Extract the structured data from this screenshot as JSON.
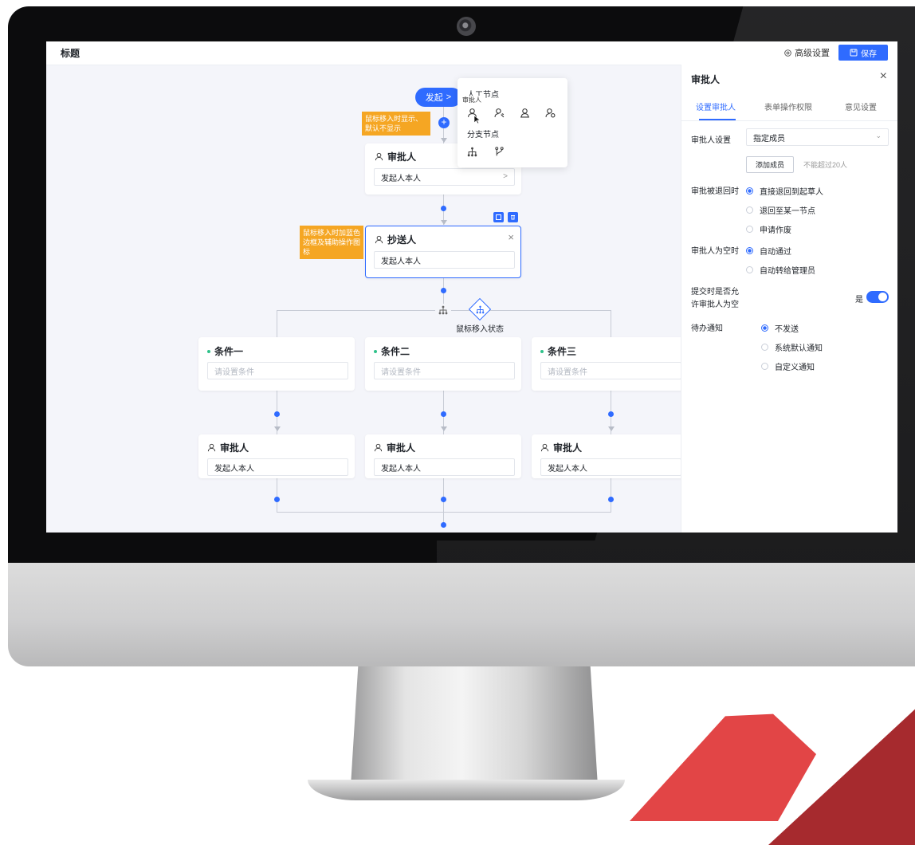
{
  "app": {
    "title": "标题",
    "advanced_label": "高级设置",
    "save_label": "保存"
  },
  "flow": {
    "start_label": "发起",
    "start_tooltip": "鼠标移入时显示、默认不显示",
    "approver_card": {
      "title": "审批人",
      "value": "发起人本人"
    },
    "cc_tooltip": "鼠标移入时加蓝色边框及辅助操作图标",
    "cc_card": {
      "title": "抄送人",
      "value": "发起人本人"
    },
    "branch_hover_label": "鼠标移入状态",
    "conditions": [
      {
        "title": "条件一",
        "placeholder": "请设置条件"
      },
      {
        "title": "条件二",
        "placeholder": "请设置条件"
      },
      {
        "title": "条件三",
        "placeholder": "请设置条件"
      }
    ],
    "branch_approvers": [
      {
        "title": "审批人",
        "value": "发起人本人"
      },
      {
        "title": "审批人",
        "value": "发起人本人"
      },
      {
        "title": "审批人",
        "value": "发起人本人"
      }
    ]
  },
  "popup": {
    "section1_title": "人工节点",
    "hover_tip": "审批人",
    "section2_title": "分支节点",
    "icons_row1": [
      "approver-icon",
      "handler-icon",
      "cc-person-icon",
      "stamp-person-icon"
    ],
    "icons_row2": [
      "branch-tree-icon",
      "parallel-branch-icon"
    ]
  },
  "panel": {
    "title": "审批人",
    "tabs": [
      "设置审批人",
      "表单操作权限",
      "意见设置"
    ],
    "active_tab": 0,
    "approver_setting": {
      "label": "审批人设置",
      "value": "指定成员"
    },
    "add_member": {
      "label": "添加成员",
      "hint": "不能超过20人"
    },
    "rejected": {
      "label": "审批被退回时",
      "options": [
        "直接退回到起草人",
        "退回至某一节点",
        "申请作废"
      ],
      "selected": 0
    },
    "empty_approver": {
      "label": "审批人为空时",
      "options": [
        "自动通过",
        "自动转给管理员"
      ],
      "selected": 0
    },
    "allow_empty": {
      "label_line1": "提交时是否允",
      "label_line2": "许审批人为空",
      "value_label": "是"
    },
    "notify": {
      "label": "待办通知",
      "options": [
        "不发送",
        "系统默认通知",
        "自定义通知"
      ],
      "selected": 0
    }
  },
  "colors": {
    "accent": "#2f6bff",
    "tooltip": "#f5a623",
    "condition_dot": "#2fc28a",
    "deco_red": "#e24546"
  }
}
